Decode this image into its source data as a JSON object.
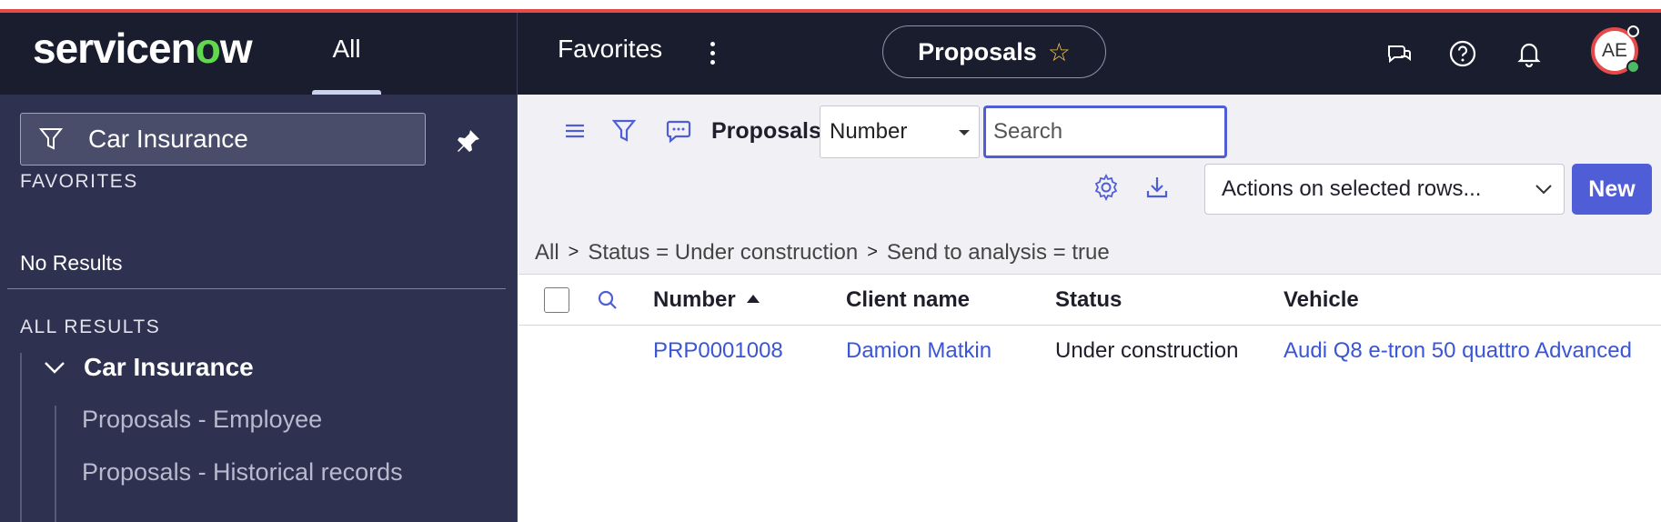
{
  "header": {
    "logo_text_a": "servicen",
    "logo_text_o": "o",
    "logo_text_b": "w",
    "all_label": "All",
    "favorites_label": "Favorites",
    "title": "Proposals",
    "avatar_initials": "AE"
  },
  "sidebar": {
    "filter_value": "Car Insurance",
    "favorites_heading": "FAVORITES",
    "no_results": "No Results",
    "all_results_heading": "ALL RESULTS",
    "tree_parent": "Car Insurance",
    "tree_children": [
      "Proposals - Employee",
      "Proposals - Historical records"
    ]
  },
  "list": {
    "title": "Proposals",
    "search_field": "Number",
    "search_placeholder": "Search",
    "actions_label": "Actions on selected rows...",
    "new_label": "New"
  },
  "breadcrumb": [
    "All",
    "Status = Under construction",
    "Send to analysis = true"
  ],
  "breadcrumb_separator": ">",
  "table": {
    "columns": [
      "Number",
      "Client name",
      "Status",
      "Vehicle"
    ],
    "rows": [
      {
        "number": "PRP0001008",
        "client_name": "Damion Matkin",
        "status": "Under construction",
        "vehicle": "Audi Q8 e-tron 50 quattro Advanced"
      }
    ]
  },
  "colors": {
    "header_bg": "#1a1d2e",
    "sidebar_bg": "#2e3150",
    "accent": "#4f5ed6",
    "link": "#3a55d6",
    "logo_o": "#62d84e",
    "top_border": "#e44a4a"
  }
}
